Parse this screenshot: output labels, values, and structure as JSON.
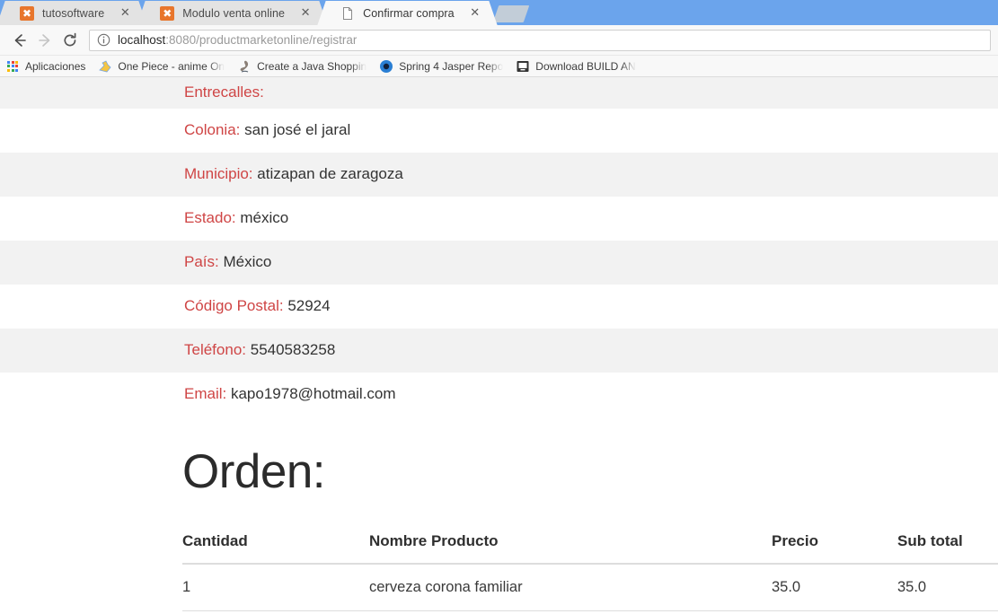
{
  "browser": {
    "tabs": [
      {
        "title": "tutosoftware",
        "favicon": "orange-x-icon",
        "active": false,
        "close_label": "✕"
      },
      {
        "title": "Modulo venta online",
        "favicon": "orange-x-icon",
        "active": false,
        "close_label": "✕"
      },
      {
        "title": "Confirmar compra",
        "favicon": "page-document-icon",
        "active": true,
        "close_label": "✕"
      }
    ],
    "new_tab_label": "",
    "toolbar": {
      "back_icon": "back-arrow-icon",
      "forward_icon": "forward-arrow-icon",
      "reload_icon": "reload-icon",
      "info_icon": "page-info-icon",
      "url_host": "localhost",
      "url_path": ":8080/productmarketonline/registrar",
      "url_full": "localhost:8080/productmarketonline/registrar"
    },
    "bookmarks": [
      {
        "label": "Aplicaciones",
        "icon": "apps-grid-icon"
      },
      {
        "label": "One Piece - anime On",
        "icon": "one-piece-icon"
      },
      {
        "label": "Create a Java Shoppin",
        "icon": "java-icon"
      },
      {
        "label": "Spring 4 Jasper Repo",
        "icon": "blue-circle-icon"
      },
      {
        "label": "Download BUILD AN",
        "icon": "monitor-icon"
      }
    ]
  },
  "page": {
    "details": [
      {
        "term": "Entrecalles:",
        "desc": ""
      },
      {
        "term": "Colonia:",
        "desc": "san josé el jaral"
      },
      {
        "term": "Municipio:",
        "desc": "atizapan de zaragoza"
      },
      {
        "term": "Estado:",
        "desc": "méxico"
      },
      {
        "term": "País:",
        "desc": "México"
      },
      {
        "term": "Código Postal:",
        "desc": "52924"
      },
      {
        "term": "Teléfono:",
        "desc": "5540583258"
      },
      {
        "term": "Email:",
        "desc": "kapo1978@hotmail.com"
      }
    ],
    "order_heading": "Orden:",
    "order_table": {
      "columns": [
        "Cantidad",
        "Nombre Producto",
        "Precio",
        "Sub total"
      ],
      "rows": [
        [
          "1",
          "cerveza corona familiar",
          "35.0",
          "35.0"
        ]
      ]
    }
  },
  "colors": {
    "label_red": "#cf4545",
    "stripe_gray": "#f2f2f2",
    "tab_active": "#f8f8f8",
    "titlebar_blue": "#6ba4ec"
  }
}
